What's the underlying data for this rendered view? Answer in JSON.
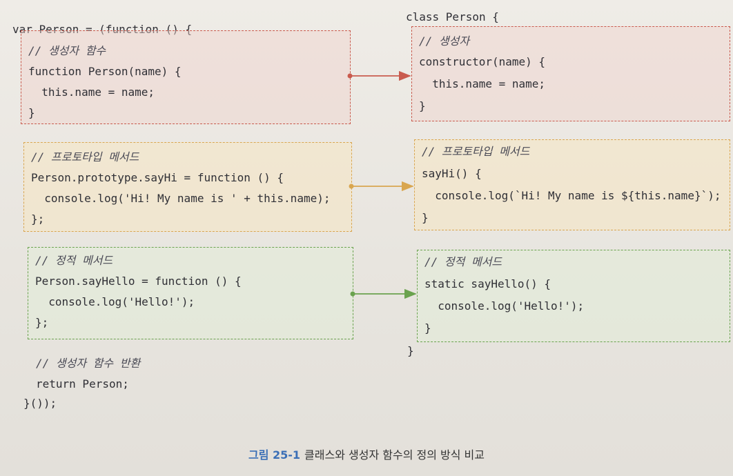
{
  "left": {
    "header": "var Person = (function () {",
    "ctor_comment": "// 생성자 함수",
    "ctor_line1": "function Person(name) {",
    "ctor_line2": "  this.name = name;",
    "ctor_line3": "}",
    "proto_comment": "// 프로토타입 메서드",
    "proto_line1": "Person.prototype.sayHi = function () {",
    "proto_line2": "  console.log('Hi! My name is ' + this.name);",
    "proto_line3": "};",
    "static_comment": "// 정적 메서드",
    "static_line1": "Person.sayHello = function () {",
    "static_line2": "  console.log('Hello!');",
    "static_line3": "};",
    "return_comment": "// 생성자 함수 반환",
    "return_line": "return Person;",
    "footer": "}());"
  },
  "right": {
    "header": "class Person {",
    "ctor_comment": "// 생성자",
    "ctor_line1": "constructor(name) {",
    "ctor_line2": "  this.name = name;",
    "ctor_line3": "}",
    "proto_comment": "// 프로토타입 메서드",
    "proto_line1": "sayHi() {",
    "proto_line2": "  console.log(`Hi! My name is ${this.name}`);",
    "proto_line3": "}",
    "static_comment": "// 정적 메서드",
    "static_line1": "static sayHello() {",
    "static_line2": "  console.log('Hello!');",
    "static_line3": "}",
    "footer": "}"
  },
  "caption": {
    "number": "그림 25-1",
    "text": "클래스와 생성자 함수의 정의 방식 비교"
  },
  "colors": {
    "constructor_box": "#c95b4e",
    "prototype_box": "#d9a650",
    "static_box": "#6aa24e",
    "caption_number": "#3b6fb6"
  }
}
